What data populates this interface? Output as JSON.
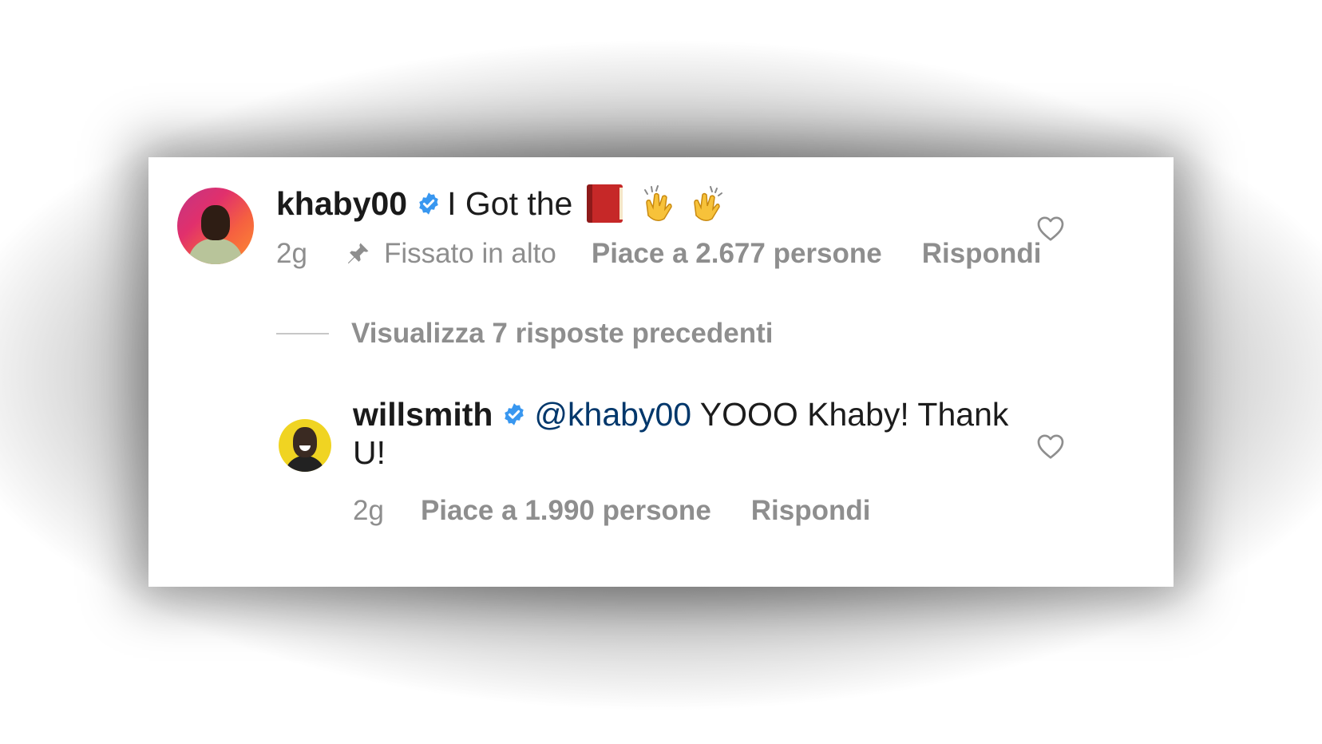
{
  "comments": [
    {
      "username": "khaby00",
      "verified": true,
      "text": "I Got the",
      "emoji": [
        "book-emoji",
        "clapping-hands-emoji",
        "clapping-hands-emoji"
      ],
      "time": "2g",
      "pinned_label": "Fissato in alto",
      "likes_label": "Piace a 2.677 persone",
      "reply_label": "Rispondi"
    },
    {
      "username": "willsmith",
      "verified": true,
      "mention": "@khaby00",
      "text": "YOOO Khaby! Thank U!",
      "time": "2g",
      "likes_label": "Piace a 1.990 persone",
      "reply_label": "Rispondi"
    }
  ],
  "view_replies_label": "Visualizza 7 risposte precedenti",
  "colors": {
    "verified_badge": "#3897f0",
    "mention": "#00376b",
    "meta_text": "#8e8e8e",
    "primary_text": "#1c1c1c"
  }
}
